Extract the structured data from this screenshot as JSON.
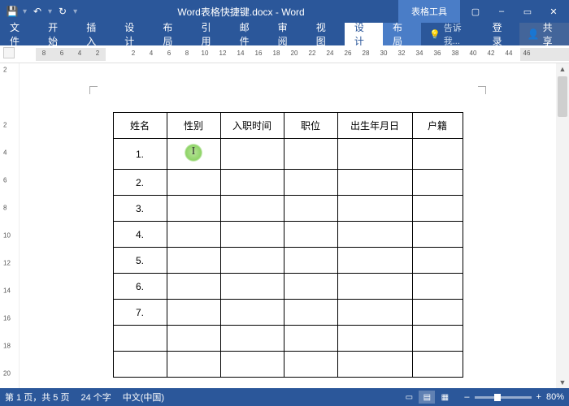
{
  "titlebar": {
    "doc_title": "Word表格快捷键.docx - Word",
    "context_tab": "表格工具"
  },
  "qat": {
    "save": "💾",
    "undo": "↶",
    "redo": "↻"
  },
  "win": {
    "min": "–",
    "max": "▭",
    "close": "✕",
    "ribbon_opts": "▾"
  },
  "ribbon": {
    "file": "文件",
    "home": "开始",
    "insert": "插入",
    "design": "设计",
    "layout": "布局",
    "references": "引用",
    "mailings": "邮件",
    "review": "审阅",
    "view": "视图",
    "table_design": "设计",
    "table_layout": "布局",
    "tell_me": "告诉我...",
    "login": "登录",
    "share": "共享"
  },
  "ruler_ticks": [
    "8",
    "6",
    "4",
    "2",
    "",
    "2",
    "4",
    "6",
    "8",
    "10",
    "12",
    "14",
    "16",
    "18",
    "20",
    "22",
    "24",
    "26",
    "28",
    "30",
    "32",
    "34",
    "36",
    "38",
    "40",
    "42",
    "44",
    "46"
  ],
  "vruler_ticks": [
    "2",
    "",
    "2",
    "4",
    "6",
    "8",
    "10",
    "12",
    "14",
    "16",
    "18",
    "20"
  ],
  "table": {
    "headers": [
      "姓名",
      "性别",
      "入职时间",
      "职位",
      "出生年月日",
      "户籍"
    ],
    "rows": [
      [
        "1.",
        "",
        "",
        "",
        "",
        ""
      ],
      [
        "2.",
        "",
        "",
        "",
        "",
        ""
      ],
      [
        "3.",
        "",
        "",
        "",
        "",
        ""
      ],
      [
        "4.",
        "",
        "",
        "",
        "",
        ""
      ],
      [
        "5.",
        "",
        "",
        "",
        "",
        ""
      ],
      [
        "6.",
        "",
        "",
        "",
        "",
        ""
      ],
      [
        "7.",
        "",
        "",
        "",
        "",
        ""
      ],
      [
        "",
        "",
        "",
        "",
        "",
        ""
      ],
      [
        "",
        "",
        "",
        "",
        "",
        ""
      ]
    ]
  },
  "statusbar": {
    "page_info": "第 1 页，共 5 页",
    "word_count": "24 个字",
    "language": "中文(中国)",
    "zoom_pct": "80%",
    "zoom_minus": "–",
    "zoom_plus": "+"
  }
}
